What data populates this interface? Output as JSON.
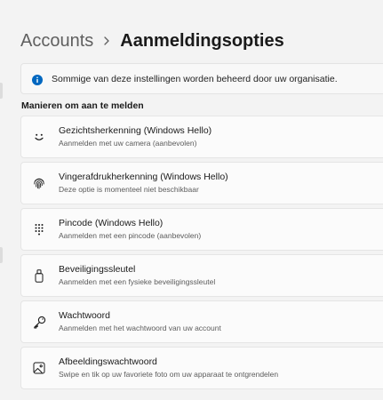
{
  "breadcrumb": {
    "parent": "Accounts",
    "separator_icon": "chevron-right-icon",
    "current": "Aanmeldingsopties"
  },
  "info_bar": {
    "icon": "info-icon",
    "text": "Sommige van deze instellingen worden beheerd door uw organisatie.",
    "accent_color": "#0067c0"
  },
  "section": {
    "heading": "Manieren om aan te melden"
  },
  "options": [
    {
      "icon": "face-icon",
      "title": "Gezichtsherkenning (Windows Hello)",
      "subtitle": "Aanmelden met uw camera (aanbevolen)"
    },
    {
      "icon": "fingerprint-icon",
      "title": "Vingerafdrukherkenning (Windows Hello)",
      "subtitle": "Deze optie is momenteel niet beschikbaar"
    },
    {
      "icon": "pin-keypad-icon",
      "title": "Pincode (Windows Hello)",
      "subtitle": "Aanmelden met een pincode (aanbevolen)"
    },
    {
      "icon": "security-key-icon",
      "title": "Beveiligingssleutel",
      "subtitle": "Aanmelden met een fysieke beveiligingssleutel"
    },
    {
      "icon": "key-icon",
      "title": "Wachtwoord",
      "subtitle": "Aanmelden met het wachtwoord van uw account"
    },
    {
      "icon": "picture-icon",
      "title": "Afbeeldingswachtwoord",
      "subtitle": "Swipe en tik op uw favoriete foto om uw apparaat te ontgrendelen"
    }
  ]
}
